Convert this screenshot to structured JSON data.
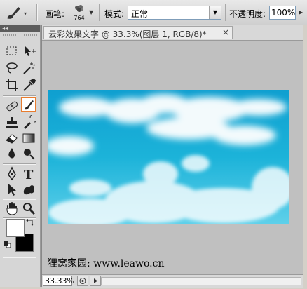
{
  "options_bar": {
    "brush_label": "画笔:",
    "brush_size": "764",
    "mode_label": "模式:",
    "mode_value": "正常",
    "opacity_label": "不透明度:",
    "opacity_value": "100%"
  },
  "toolbox": {
    "collapse_glyph": "◂◂",
    "tools": [
      "rectangular-marquee",
      "move",
      "lasso",
      "magic-wand",
      "crop",
      "eyedropper",
      "healing-brush",
      "brush",
      "clone-stamp",
      "history-brush",
      "eraser",
      "gradient",
      "blur",
      "dodge",
      "pen",
      "type",
      "path-selection",
      "custom-shape",
      "hand",
      "zoom"
    ],
    "active_tool": "brush",
    "foreground_color": "#ffffff",
    "background_color": "#000000"
  },
  "document": {
    "tab_title": "云彩效果文字 @ 33.3%(图层 1, RGB/8)*",
    "close_glyph": "×",
    "watermark": "狸窝家园: www.leawo.cn",
    "zoom": "33.33%"
  },
  "colors": {
    "sky_blue": "#14a9d2",
    "active_tool_border": "#e87c2f"
  }
}
